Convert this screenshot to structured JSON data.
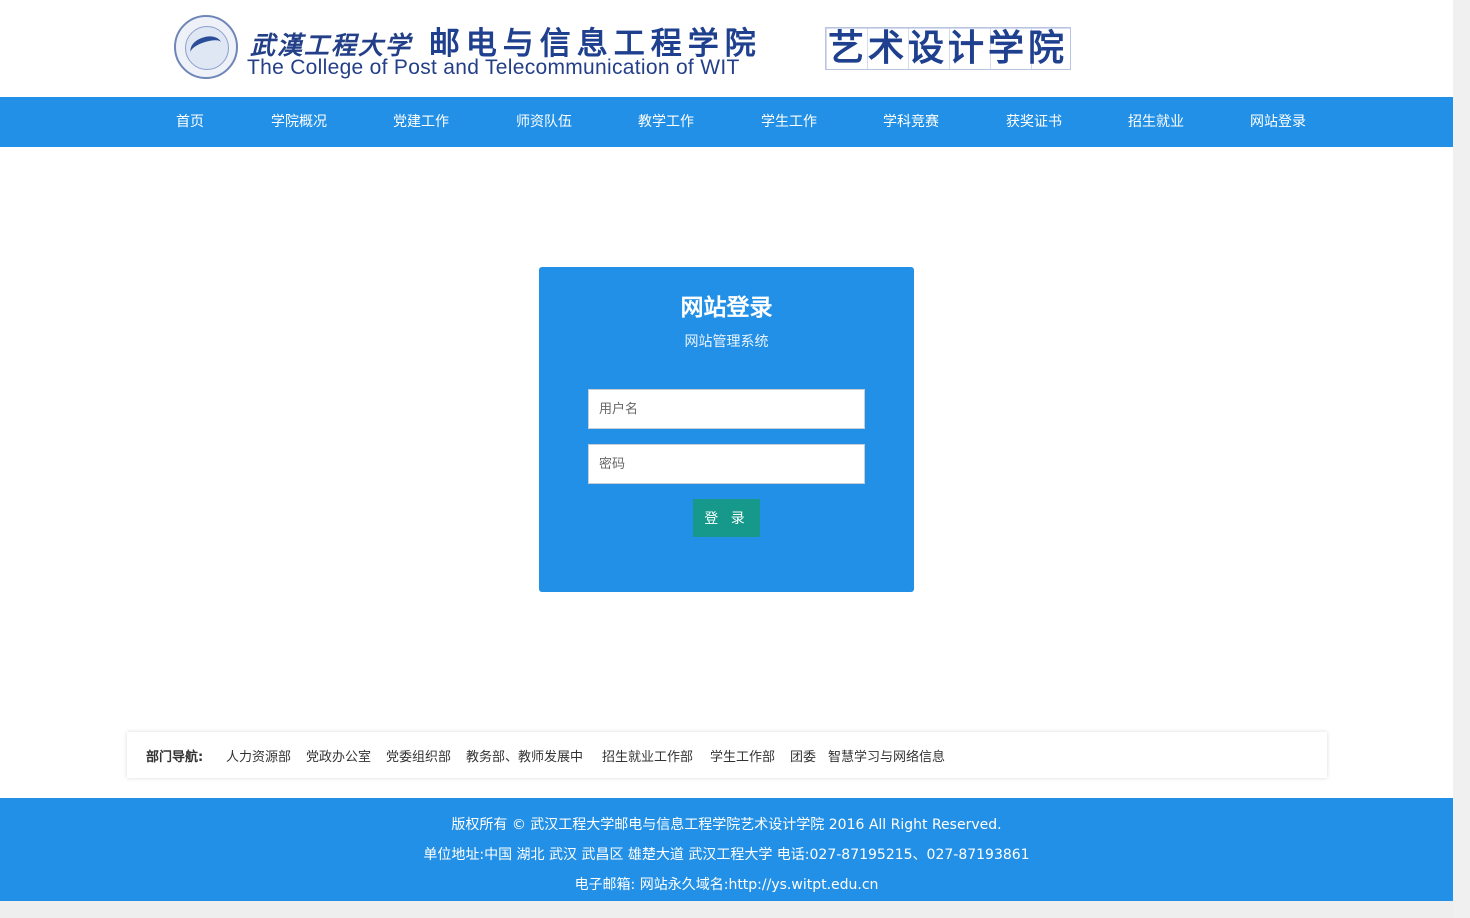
{
  "header": {
    "logo_cn_university": "武漢工程大学",
    "logo_cn_college": "邮电与信息工程学院",
    "logo_en": "The College of Post and Telecommunication of WIT",
    "logo_dept": "艺术设计学院"
  },
  "nav": {
    "items": [
      {
        "label": "首页"
      },
      {
        "label": "学院概况"
      },
      {
        "label": "党建工作"
      },
      {
        "label": "师资队伍"
      },
      {
        "label": "教学工作"
      },
      {
        "label": "学生工作"
      },
      {
        "label": "学科竞赛"
      },
      {
        "label": "获奖证书"
      },
      {
        "label": "招生就业"
      },
      {
        "label": "网站登录"
      }
    ]
  },
  "login": {
    "title": "网站登录",
    "subtitle": "网站管理系统",
    "username_placeholder": "用户名",
    "username_value": "",
    "password_placeholder": "密码",
    "password_value": "",
    "submit_label": "登 录"
  },
  "dept_nav": {
    "label": "部门导航:",
    "links": [
      {
        "label": "人力资源部"
      },
      {
        "label": "党政办公室"
      },
      {
        "label": "党委组织部"
      },
      {
        "label": "教务部、教师发展中"
      },
      {
        "label": "招生就业工作部"
      },
      {
        "label": "学生工作部"
      },
      {
        "label": "团委"
      },
      {
        "label": "智慧学习与网络信息"
      }
    ]
  },
  "footer": {
    "copyright": "版权所有 © 武汉工程大学邮电与信息工程学院艺术设计学院 2016 All Right Reserved.",
    "address": "单位地址:中国 湖北 武汉 武昌区 雄楚大道 武汉工程大学 电话:027-87195215、027-87193861",
    "contact": "电子邮箱: 网站永久域名:http://ys.witpt.edu.cn"
  },
  "colors": {
    "primary": "#2290e6",
    "button": "#16998a",
    "logo_text": "#1f3f8f"
  }
}
